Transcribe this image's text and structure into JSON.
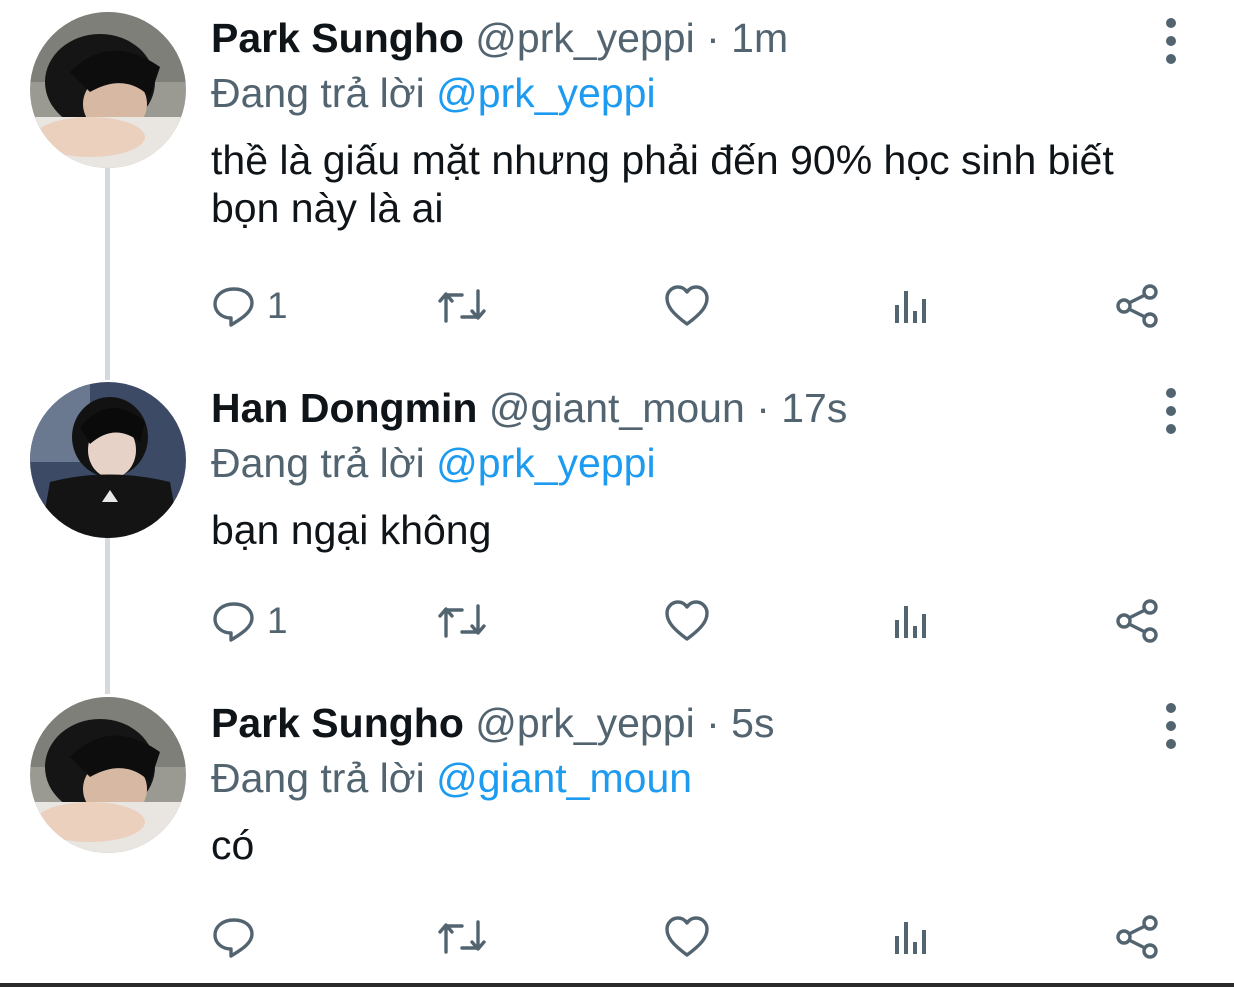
{
  "thread": {
    "tweets": [
      {
        "name": "Park Sungho",
        "handle": "@prk_yeppi",
        "separator": "·",
        "time": "1m",
        "replying_label": "Đang trả lời",
        "replying_to": "@prk_yeppi",
        "text": "thề là giấu mặt nhưng phải đến 90% học sinh biết bọn này là ai",
        "reply_count": "1",
        "avatar": "person-lying-avatar"
      },
      {
        "name": "Han Dongmin",
        "handle": "@giant_moun",
        "separator": "·",
        "time": "17s",
        "replying_label": "Đang trả lời",
        "replying_to": "@prk_yeppi",
        "text": "bạn ngại không",
        "reply_count": "1",
        "avatar": "person-black-hoodie-avatar"
      },
      {
        "name": "Park Sungho",
        "handle": "@prk_yeppi",
        "separator": "·",
        "time": "5s",
        "replying_label": "Đang trả lời",
        "replying_to": "@giant_moun",
        "text": "có",
        "reply_count": "",
        "avatar": "person-lying-avatar"
      }
    ]
  },
  "colors": {
    "text_primary": "#0f1419",
    "text_secondary": "#536471",
    "mention": "#1d9bf0",
    "thread_line": "#d6d9db"
  },
  "icons": [
    "reply-icon",
    "retweet-icon",
    "like-icon",
    "analytics-icon",
    "share-icon",
    "more-options-icon"
  ]
}
